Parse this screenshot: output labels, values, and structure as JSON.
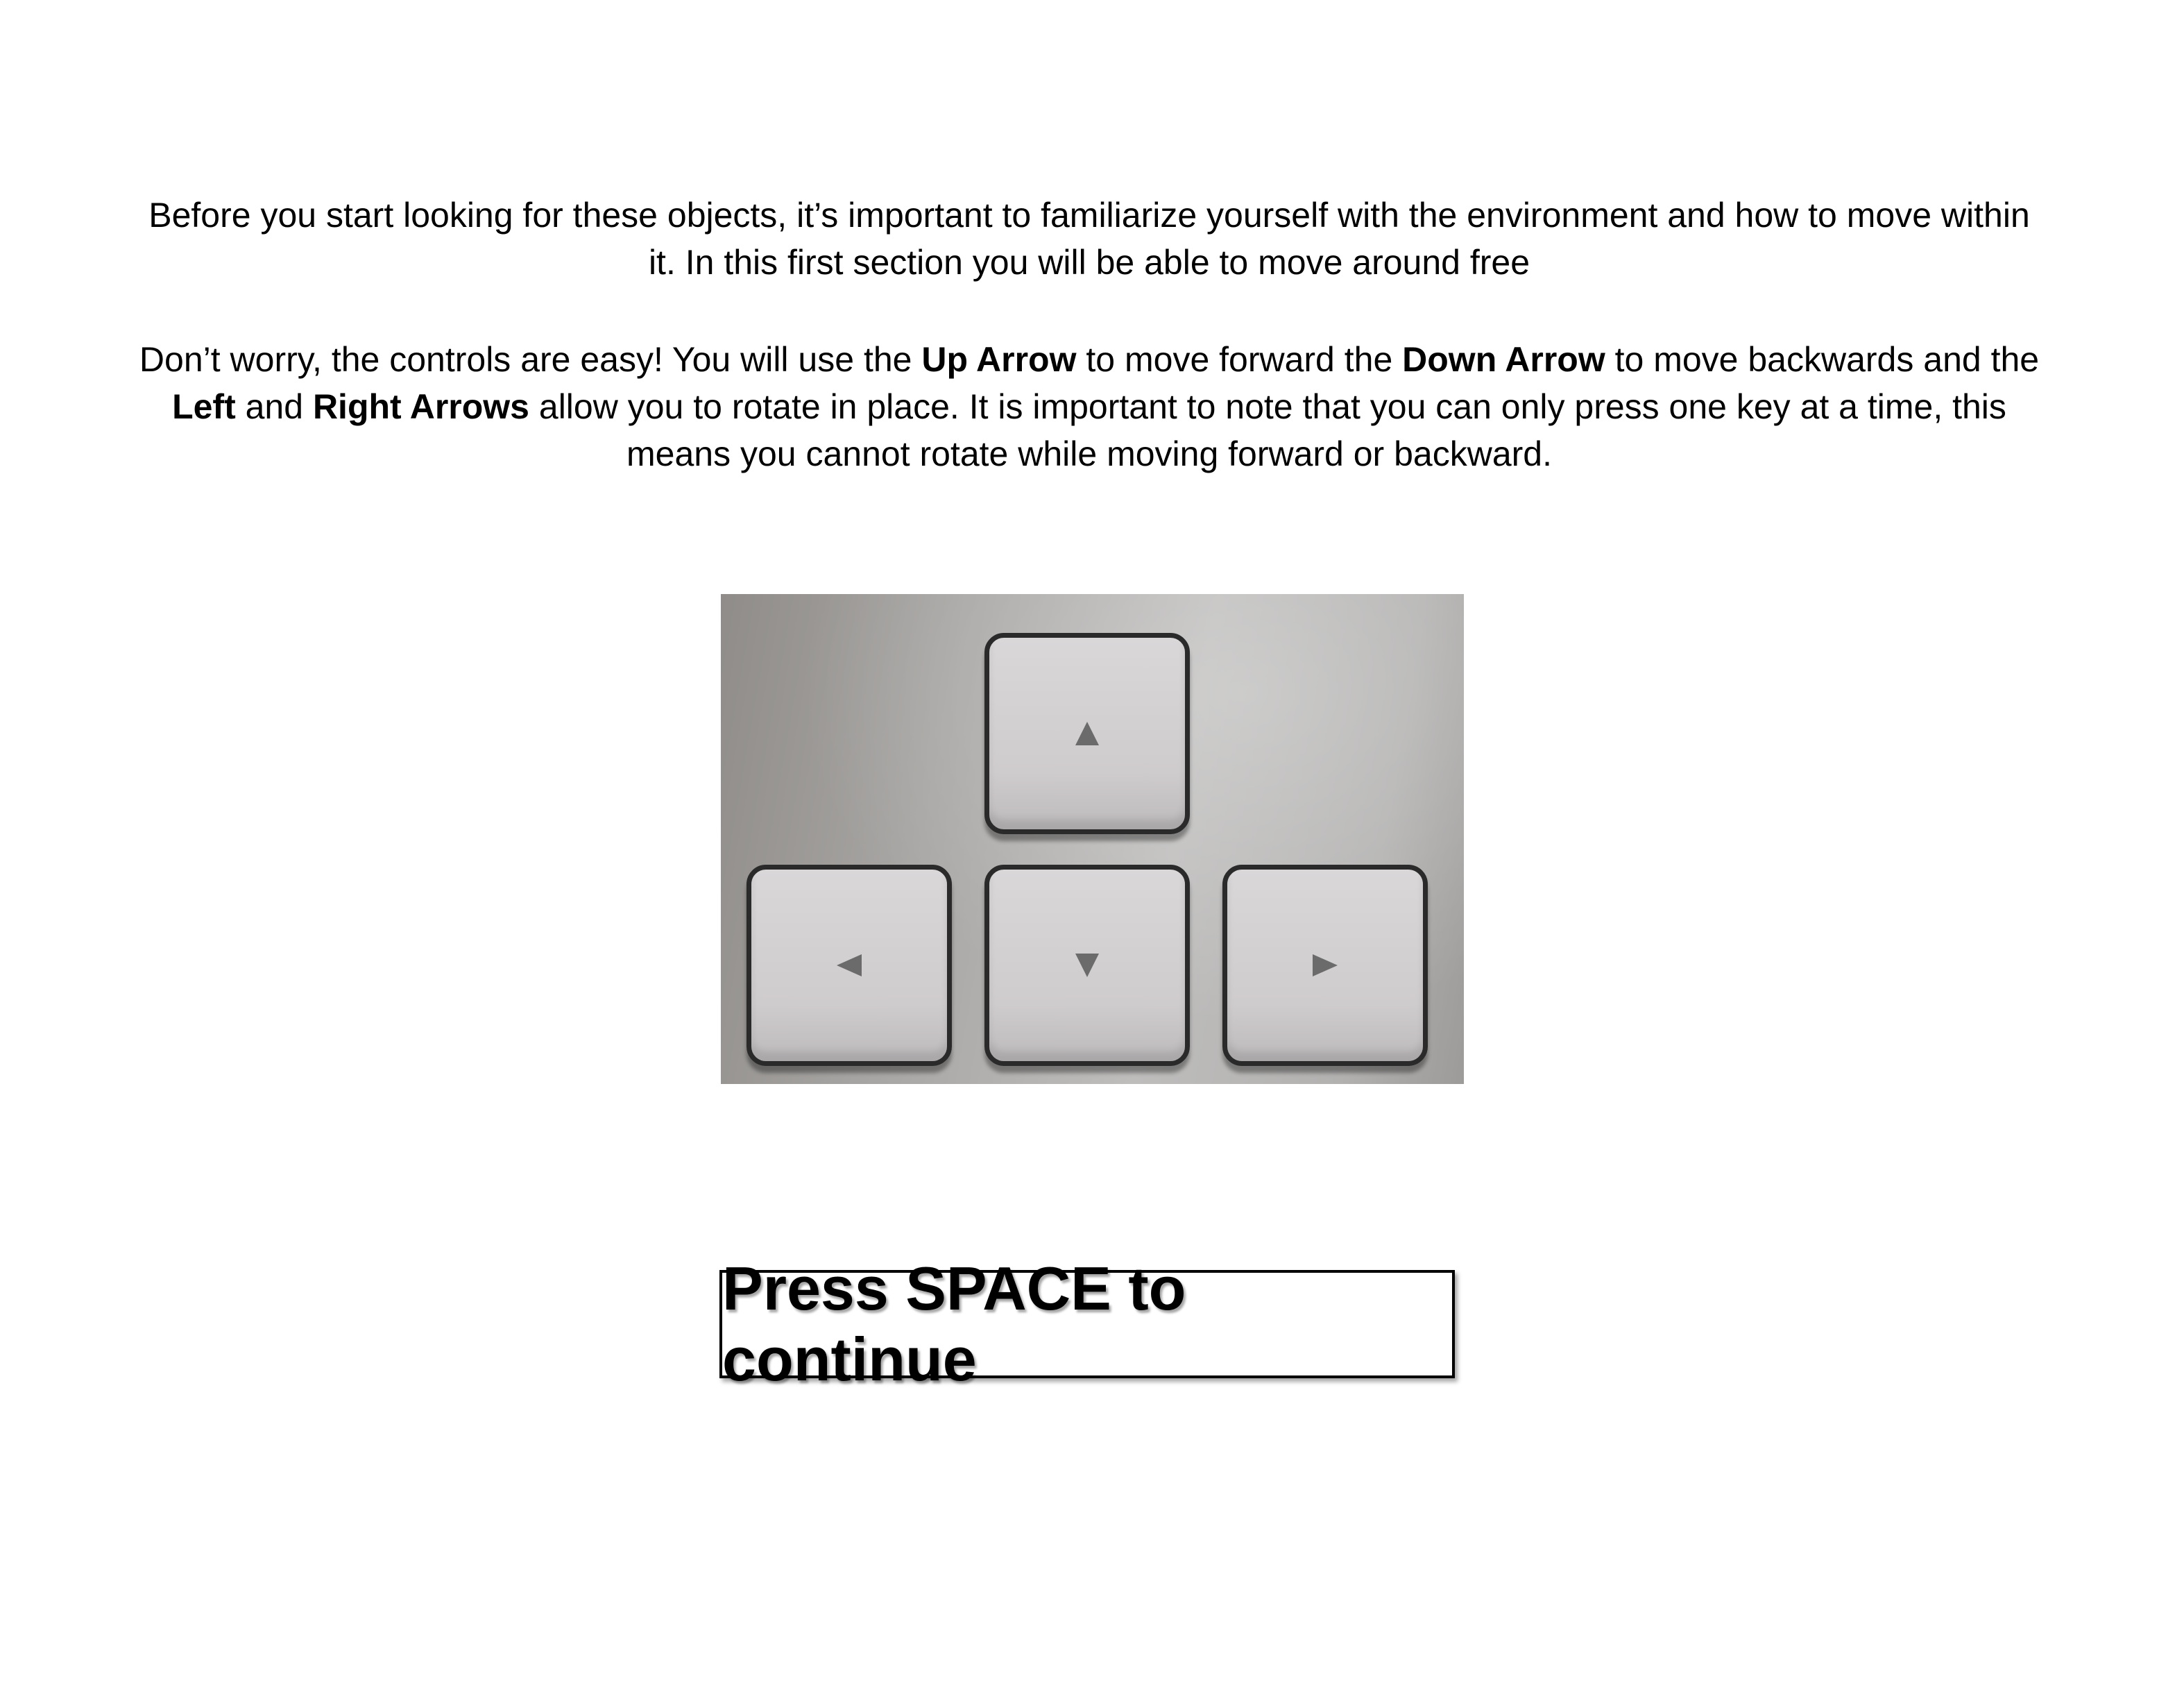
{
  "instructions": {
    "paragraph_1": "Before you start looking for these objects, it’s important to familiarize yourself with the environment and how to move within it. In this first section you will be able to move around free",
    "paragraph_2": {
      "t1": "Don’t worry, the controls are easy! You will use the ",
      "b1": "Up Arrow",
      "t2": " to move forward the ",
      "b2": "Down Arrow",
      "t3": " to move backwards and the ",
      "b3": "Left",
      "t4": " and ",
      "b4": "Right Arrows",
      "t5": " allow you to rotate in place. It is important to note that you can only press one key at a time, this means you cannot rotate while moving forward or backward."
    }
  },
  "image": {
    "keys": [
      {
        "name": "up-arrow-key",
        "icon": "up-arrow-icon"
      },
      {
        "name": "left-arrow-key",
        "icon": "left-arrow-icon"
      },
      {
        "name": "down-arrow-key",
        "icon": "down-arrow-icon"
      },
      {
        "name": "right-arrow-key",
        "icon": "right-arrow-icon"
      }
    ]
  },
  "continue_button": {
    "label": "Press SPACE to continue"
  }
}
